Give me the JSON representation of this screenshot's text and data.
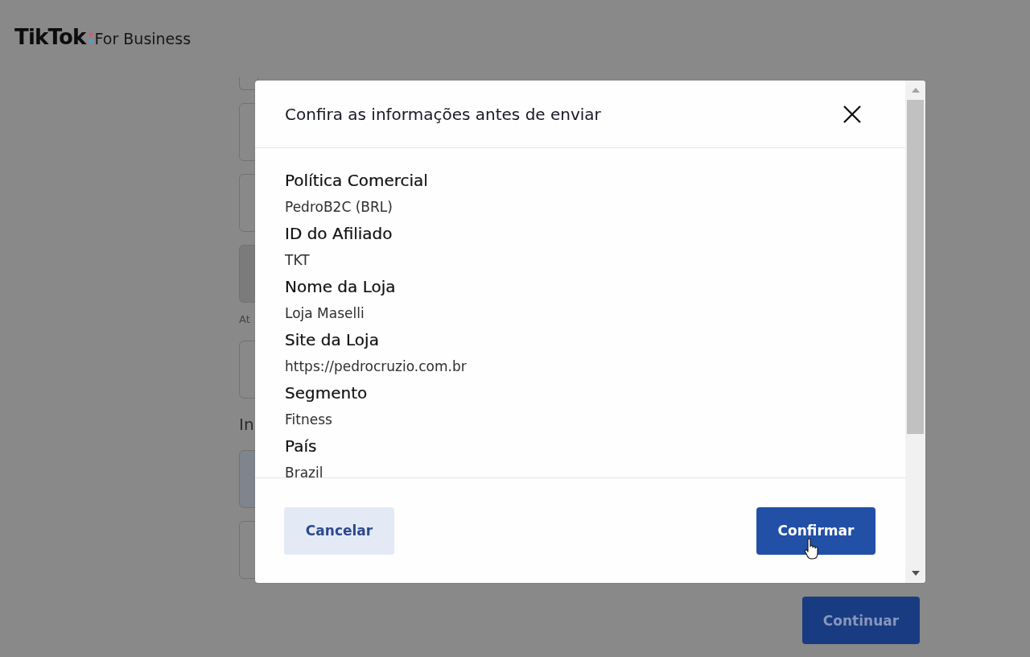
{
  "logo": {
    "wordmark": "TikTok",
    "suffix": "For Business"
  },
  "background_form": {
    "items": [
      {
        "kind": "stub"
      },
      {
        "kind": "outlined"
      },
      {
        "kind": "outlined"
      },
      {
        "kind": "shaded"
      },
      {
        "kind": "hint",
        "text": "At"
      },
      {
        "kind": "outlined"
      },
      {
        "kind": "heading",
        "text": "In"
      },
      {
        "kind": "tinted"
      },
      {
        "kind": "outlined"
      }
    ],
    "continue_button": "Continuar"
  },
  "dialog": {
    "title": "Confira as informações antes de enviar",
    "fields": [
      {
        "label": "Política Comercial",
        "value": "PedroB2C (BRL)"
      },
      {
        "label": "ID do Afiliado",
        "value": "TKT"
      },
      {
        "label": "Nome da Loja",
        "value": "Loja Maselli"
      },
      {
        "label": "Site da Loja",
        "value": "https://pedrocruzio.com.br"
      },
      {
        "label": "Segmento",
        "value": "Fitness"
      },
      {
        "label": "País",
        "value": "Brazil"
      }
    ],
    "buttons": [
      {
        "label": "Cancelar",
        "kind": "secondary"
      },
      {
        "label": "Confirmar",
        "kind": "primary"
      }
    ]
  }
}
